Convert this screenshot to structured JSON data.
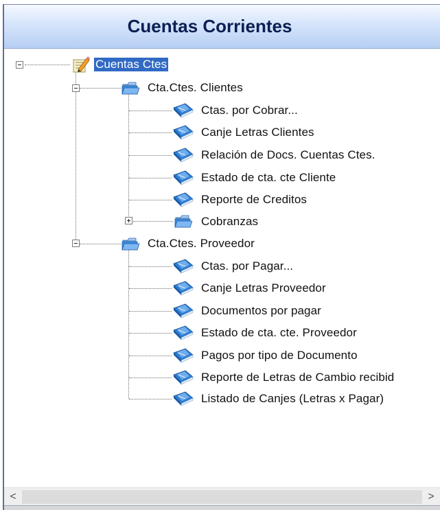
{
  "panel": {
    "title": "Cuentas Corrientes"
  },
  "tree": {
    "root": {
      "label": "Cuentas Ctes",
      "selected": true,
      "expanded": true,
      "icon": "notepad-pencil-icon"
    },
    "clientes": {
      "label": "Cta.Ctes. Clientes",
      "expanded": true,
      "icon": "open-folder-icon",
      "items": [
        "Ctas. por Cobrar...",
        "Canje Letras Clientes",
        "Relación de Docs. Cuentas Ctes.",
        "Estado de cta. cte Cliente",
        "Reporte de Creditos"
      ],
      "cobranzas": {
        "label": "Cobranzas",
        "expanded": false,
        "icon": "open-folder-icon"
      }
    },
    "proveedor": {
      "label": "Cta.Ctes.  Proveedor",
      "expanded": true,
      "icon": "open-folder-icon",
      "items": [
        "Ctas. por Pagar...",
        "Canje Letras Proveedor",
        "Documentos por pagar",
        "Estado de cta. cte. Proveedor",
        "Pagos por tipo de Documento",
        "Reporte de Letras de Cambio recibid",
        "Listado de Canjes (Letras x Pagar)"
      ]
    },
    "item_icon": "report-book-icon"
  },
  "scrollbar": {
    "left_arrow": "<",
    "right_arrow": ">"
  },
  "colors": {
    "header_text": "#0b1f52",
    "selection": "#316ac5"
  }
}
